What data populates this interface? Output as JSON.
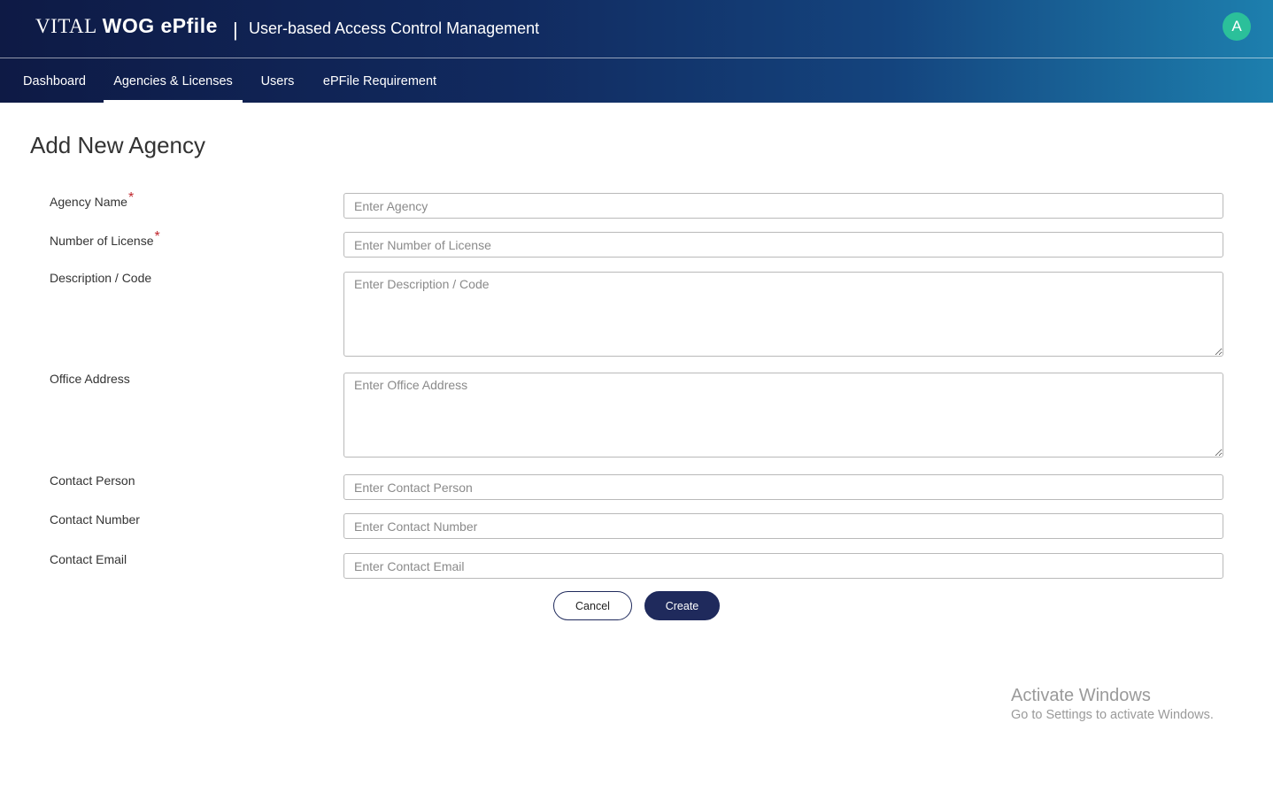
{
  "header": {
    "brand_vital": "VITAL",
    "brand_wog": "WOG ePfile",
    "separator": "|",
    "app_title": "User-based Access Control Management",
    "avatar_initial": "A",
    "avatar_color": "#2bc09a"
  },
  "nav": {
    "items": [
      {
        "label": "Dashboard",
        "active": false
      },
      {
        "label": "Agencies & Licenses",
        "active": true
      },
      {
        "label": "Users",
        "active": false
      },
      {
        "label": "ePFile Requirement",
        "active": false
      }
    ]
  },
  "form": {
    "title": "Add New Agency",
    "required_marker": "*",
    "fields": [
      {
        "label": "Agency Name",
        "required": true,
        "placeholder": "Enter Agency",
        "value": ""
      },
      {
        "label": "Number of License",
        "required": true,
        "placeholder": "Enter Number of License",
        "value": ""
      },
      {
        "label": "Description / Code",
        "required": false,
        "placeholder": "Enter Description / Code",
        "value": ""
      },
      {
        "label": "Office Address",
        "required": false,
        "placeholder": "Enter Office Address",
        "value": ""
      },
      {
        "label": "Contact Person",
        "required": false,
        "placeholder": "Enter Contact Person",
        "value": ""
      },
      {
        "label": "Contact Number",
        "required": false,
        "placeholder": "Enter Contact Number",
        "value": ""
      },
      {
        "label": "Contact Email",
        "required": false,
        "placeholder": "Enter Contact Email",
        "value": ""
      }
    ],
    "cancel_label": "Cancel",
    "create_label": "Create"
  },
  "watermark": {
    "title": "Activate Windows",
    "subtitle": "Go to Settings to activate Windows."
  },
  "colors": {
    "header_gradient_start": "#0e1a45",
    "header_gradient_end": "#1d7fae",
    "primary_button": "#1f2a5c",
    "required_marker": "#c0262d"
  }
}
